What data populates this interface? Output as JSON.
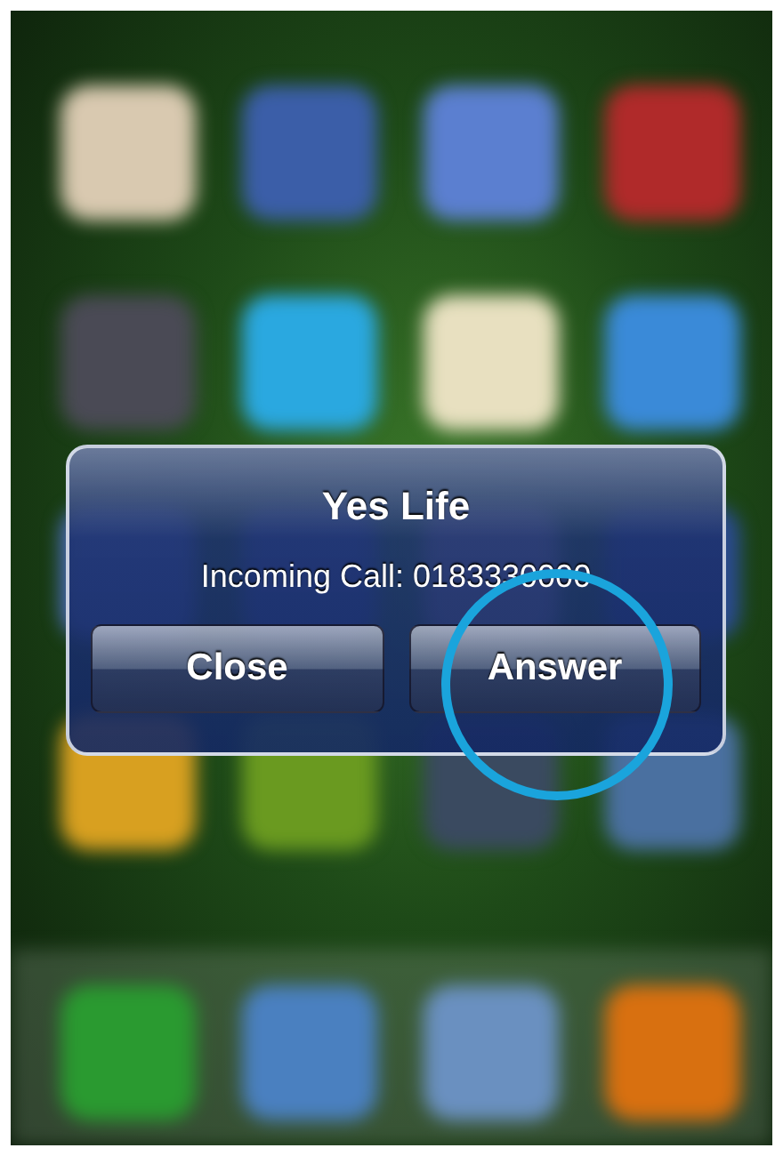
{
  "alert": {
    "title": "Yes Life",
    "message": "Incoming Call: 0183330000",
    "buttons": [
      {
        "label": "Close",
        "circled": false
      },
      {
        "label": "Answer",
        "circled": true
      }
    ]
  }
}
